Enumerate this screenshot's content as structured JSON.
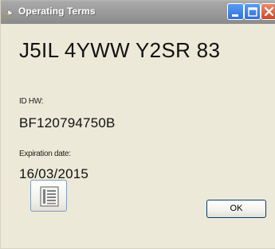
{
  "window": {
    "title": "Operating Terms",
    "title_icon": "tools-icon",
    "controls": [
      "minimize-icon",
      "maximize-icon",
      "close-icon"
    ]
  },
  "license": {
    "serial": "J5IL 4YWW Y2SR 83",
    "id_hw_label": "ID HW:",
    "id_hw_value": "BF120794750B",
    "expiration_label": "Expiration date:",
    "expiration_value": "16/03/2015"
  },
  "buttons": {
    "details_icon": "list-document-icon",
    "ok_label": "OK"
  },
  "colors": {
    "titlebar": "#9a9a9a",
    "window_bg": "#ece9d8",
    "button_border": "#003c74"
  }
}
